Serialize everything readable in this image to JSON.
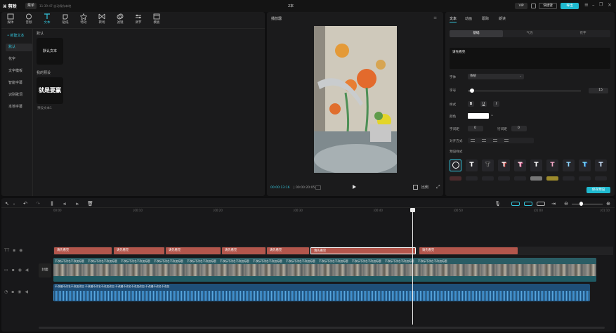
{
  "app": {
    "logo": "剪映",
    "menu_label": "菜单",
    "autosave_text": "11:39:47 自动保存本地",
    "project_title": "2本",
    "pro_badge": "VIP",
    "shortcut_label": "快捷键",
    "export_label": "导出"
  },
  "toolbar": [
    {
      "label": "媒体",
      "icon": "media-icon"
    },
    {
      "label": "音频",
      "icon": "audio-icon"
    },
    {
      "label": "文本",
      "icon": "text-icon",
      "active": true
    },
    {
      "label": "贴纸",
      "icon": "sticker-icon"
    },
    {
      "label": "特效",
      "icon": "effects-icon"
    },
    {
      "label": "转场",
      "icon": "transition-icon"
    },
    {
      "label": "滤镜",
      "icon": "filter-icon"
    },
    {
      "label": "调节",
      "icon": "adjust-icon"
    },
    {
      "label": "模板",
      "icon": "template-icon"
    }
  ],
  "text_panel": {
    "new_text": "• 新建文本",
    "categories": [
      "默认",
      "花字",
      "文字模板",
      "智能字幕",
      "识别歌词",
      "本地字幕"
    ],
    "section_default": "默认",
    "default_card": "默认文本",
    "section_mine": "我的预设",
    "preset_card": "就是要赢",
    "preset_caption": "预设文本1"
  },
  "player": {
    "title": "播放器",
    "current_time": "00:00:13:16",
    "total_time": "00:00:20:05",
    "ratio_label": "比例"
  },
  "inspector": {
    "tabs": [
      "文本",
      "动画",
      "跟踪",
      "朗读"
    ],
    "subtabs": [
      "基础",
      "气泡",
      "花字"
    ],
    "text_content": "请先看完",
    "font_label": "字体",
    "font_value": "系统",
    "size_label": "字号",
    "size_value": "15",
    "style_label": "样式",
    "style_buttons": [
      "B",
      "U",
      "I"
    ],
    "color_label": "颜色",
    "char_spacing_label": "字间距",
    "char_spacing_value": "0",
    "line_spacing_label": "行间距",
    "line_spacing_value": "0",
    "align_label": "对齐方式",
    "preset_styles_label": "预设样式",
    "preset_letter": "T",
    "save_preset_label": "保存预设"
  },
  "timeline": {
    "ruler": [
      "00:00",
      "|00:10",
      "|00:20",
      "|00:30",
      "|00:40",
      "|00:50",
      "|01:00",
      "|01:10"
    ],
    "cover_label": "封面",
    "subtitle_segments": [
      "请先看完",
      "请先看完",
      "请先看完",
      "请先看完",
      "请先看完",
      "请先看完",
      "请先看完"
    ],
    "clip_label": "不改标不改名不改加标题",
    "audio_label": "不改编不改名不改加改加 不改编不改名不改加改加 不改编不改名不改加改加 不改编不改名不改加"
  },
  "colors": {
    "accent": "#33c2d9",
    "subtitle_track": "#b3564c",
    "video_track": "#2f6e78",
    "audio_track": "#1f6fa3"
  }
}
